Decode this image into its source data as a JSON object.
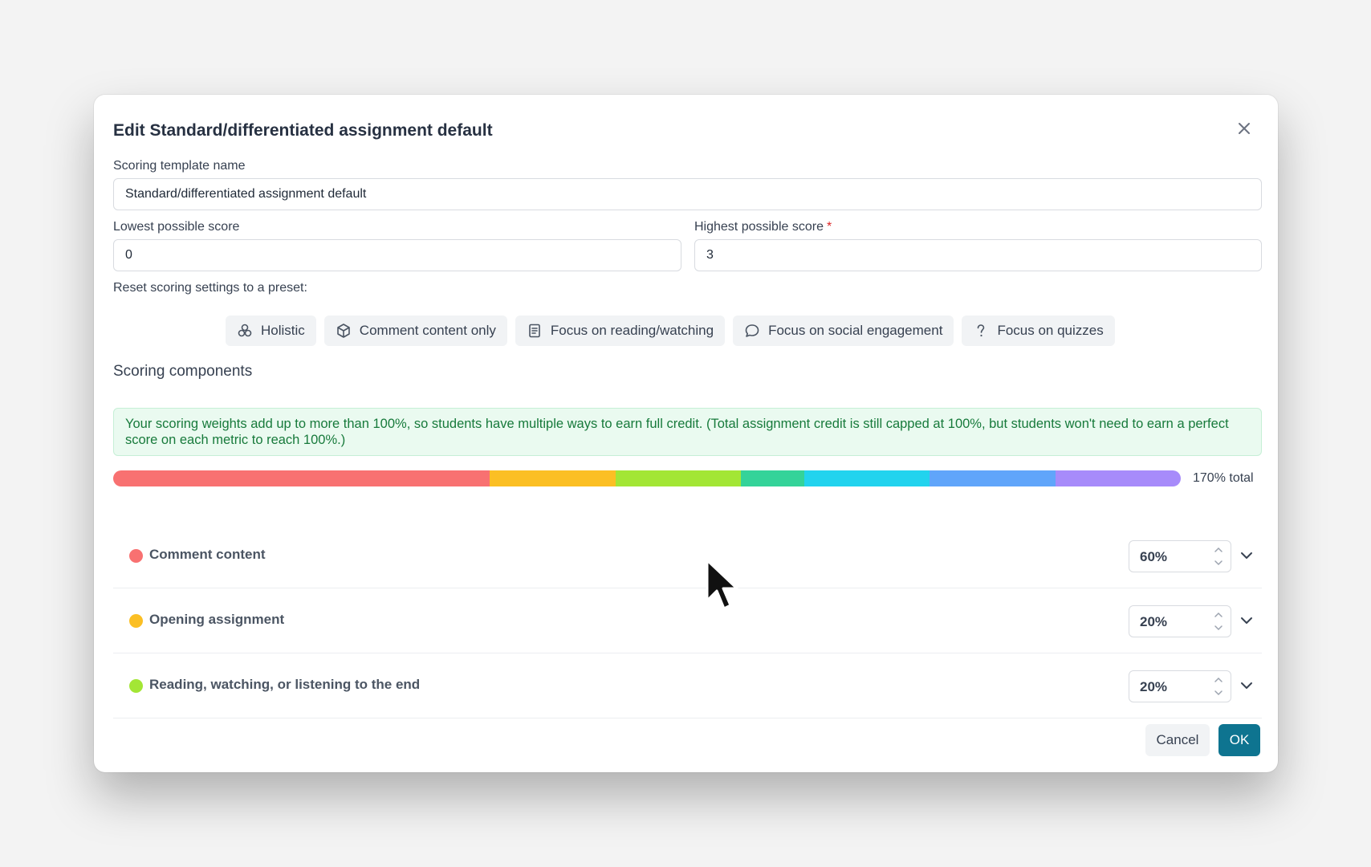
{
  "dialog": {
    "title": "Edit Standard/differentiated assignment default"
  },
  "template_name": {
    "label": "Scoring template name",
    "value": "Standard/differentiated assignment default"
  },
  "lowest_score": {
    "label": "Lowest possible score",
    "value": "0"
  },
  "highest_score": {
    "label": "Highest possible score",
    "required_mark": "*",
    "value": "3"
  },
  "presets": {
    "label": "Reset scoring settings to a preset:",
    "items": [
      {
        "label": "Holistic",
        "icon": "holistic-icon"
      },
      {
        "label": "Comment content only",
        "icon": "cube-icon"
      },
      {
        "label": "Focus on reading/watching",
        "icon": "document-icon"
      },
      {
        "label": "Focus on social engagement",
        "icon": "chat-bubble-icon"
      },
      {
        "label": "Focus on quizzes",
        "icon": "question-icon"
      }
    ]
  },
  "components": {
    "title": "Scoring components",
    "notice": "Your scoring weights add up to more than 100%, so students have multiple ways to earn full credit. (Total assignment credit is still capped at 100%, but students won't need to earn a perfect score on each metric to reach 100%.)",
    "total_label": "170% total",
    "bar_segments": [
      {
        "color": "#f87171",
        "weight": 60
      },
      {
        "color": "#fbbf24",
        "weight": 20
      },
      {
        "color": "#a3e635",
        "weight": 20
      },
      {
        "color": "#34d399",
        "weight": 10
      },
      {
        "color": "#22d3ee",
        "weight": 20
      },
      {
        "color": "#60a5fa",
        "weight": 20
      },
      {
        "color": "#a78bfa",
        "weight": 20
      }
    ],
    "rows": [
      {
        "label": "Comment content",
        "value": "60%",
        "color": "#f87171"
      },
      {
        "label": "Opening assignment",
        "value": "20%",
        "color": "#fbbf24"
      },
      {
        "label": "Reading, watching, or listening to the end",
        "value": "20%",
        "color": "#a3e635"
      }
    ]
  },
  "footer": {
    "cancel_label": "Cancel",
    "ok_label": "OK"
  },
  "colors": {
    "accent": "#0e7490",
    "notice_text": "#177a3b",
    "required": "#dc2626"
  }
}
